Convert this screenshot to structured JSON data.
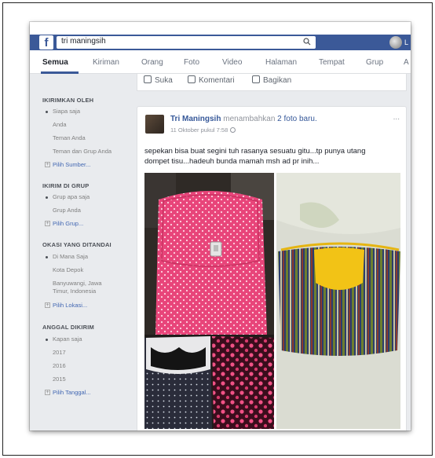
{
  "search": {
    "query": "tri maningsih"
  },
  "top": {
    "profile_initial": "L"
  },
  "tabs": [
    {
      "label": "Semua"
    },
    {
      "label": "Kiriman"
    },
    {
      "label": "Orang"
    },
    {
      "label": "Foto"
    },
    {
      "label": "Video"
    },
    {
      "label": "Halaman"
    },
    {
      "label": "Tempat"
    },
    {
      "label": "Grup"
    },
    {
      "label": "A"
    }
  ],
  "sidebar": {
    "posted_by": {
      "title": "IKIRIMKAN OLEH",
      "options": [
        "Siapa saja",
        "Anda",
        "Teman Anda",
        "Teman dan Grup Anda"
      ],
      "more": "Pilih Sumber..."
    },
    "posted_in_group": {
      "title": "IKIRIM DI GRUP",
      "options": [
        "Grup apa saja",
        "Grup Anda"
      ],
      "more": "Pilih Grup..."
    },
    "tagged_location": {
      "title": "OKASI YANG DITANDAI",
      "options": [
        "Di Mana Saja",
        "Kota Depok",
        "Banyuwangi, Jawa",
        "Timur, Indonesia"
      ],
      "more": "Pilih Lokasi..."
    },
    "date_posted": {
      "title": "ANGGAL DIKIRIM",
      "options": [
        "Kapan saja",
        "2017",
        "2016",
        "2015"
      ],
      "more": "Pilih Tanggal..."
    }
  },
  "actions": {
    "like": "Suka",
    "comment": "Komentari",
    "share": "Bagikan"
  },
  "post": {
    "author": "Tri Maningsih",
    "action_text": "menambahkan",
    "action_link": "2 foto baru.",
    "time": "11 Oktober pukul 7:58",
    "menu": "...",
    "text_line1": "sepekan bisa buat segini tuh rasanya sesuatu gitu...tp punya utang",
    "text_line2": "dompet tisu...hadeuh bunda mamah msh ad pr inih..."
  },
  "colors": {
    "brand": "#3b5998",
    "link": "#365899",
    "pink_bag": "#e8457a",
    "yellow_flap": "#f2c316"
  }
}
